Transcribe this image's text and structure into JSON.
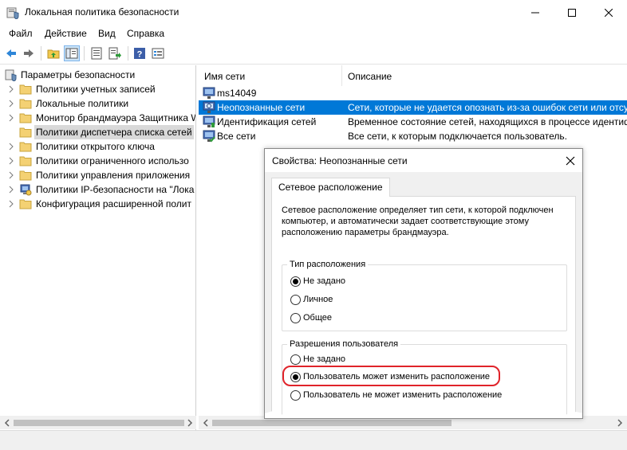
{
  "window": {
    "title": "Локальная политика безопасности",
    "minimize_icon": "minimize-icon",
    "maximize_icon": "maximize-icon",
    "close_icon": "close-icon"
  },
  "menu": [
    "Файл",
    "Действие",
    "Вид",
    "Справка"
  ],
  "toolbar": {
    "icons": [
      "back-arrow-icon",
      "forward-arrow-icon",
      "up-folder-icon",
      "show-hide-tree-icon",
      "properties-icon",
      "export-list-icon",
      "help-icon",
      "view-icon"
    ]
  },
  "tree": {
    "root": "Параметры безопасности",
    "items": [
      "Политики учетных записей",
      "Локальные политики",
      "Монитор брандмауэра Защитника W",
      "Политики диспетчера списка сетей",
      "Политики открытого ключа",
      "Политики ограниченного использо",
      "Политики управления приложения",
      "Политики IP-безопасности на \"Лока",
      "Конфигурация расширенной полит"
    ],
    "selected_index": 3
  },
  "list": {
    "columns": [
      "Имя сети",
      "Описание"
    ],
    "rows": [
      {
        "name": "ms14049",
        "desc": "",
        "icon": "network-icon"
      },
      {
        "name": "Неопознанные сети",
        "desc": "Сети, которые не удается опознать из-за ошибок сети или отсу",
        "icon": "network-unidentified-icon"
      },
      {
        "name": "Идентификация сетей",
        "desc": "Временное состояние сетей, находящихся в процессе идентиф",
        "icon": "network-identifying-icon"
      },
      {
        "name": "Все сети",
        "desc": "Все сети, к которым подключается пользователь.",
        "icon": "network-all-icon"
      }
    ],
    "selected_index": 1
  },
  "dialog": {
    "title": "Свойства: Неопознанные сети",
    "tab": "Сетевое расположение",
    "description_lines": [
      "Сетевое расположение определяет тип сети, к которой подключен",
      "компьютер, и автоматически задает соответствующие этому",
      "расположению параметры брандмауэра."
    ],
    "location_type": {
      "legend": "Тип расположения",
      "options": [
        "Не задано",
        "Личное",
        "Общее"
      ],
      "selected_index": 0
    },
    "user_permissions": {
      "legend": "Разрешения пользователя",
      "options": [
        "Не задано",
        "Пользователь может изменить расположение",
        "Пользователь не может изменить расположение"
      ],
      "selected_index": 1
    },
    "highlight_color": "#e0232a"
  },
  "colors": {
    "selection": "#0078d7",
    "tree_selection": "#d9d9d9"
  }
}
